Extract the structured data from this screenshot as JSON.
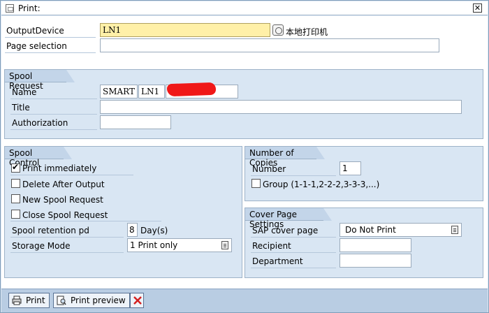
{
  "window": {
    "title": "Print:"
  },
  "output_device": {
    "label": "OutputDevice",
    "value": "LN1",
    "description": "本地打印机"
  },
  "page_selection": {
    "label": "Page selection",
    "value": ""
  },
  "spool_request": {
    "heading": "Spool Request",
    "name_label": "Name",
    "name_part1": "SMART",
    "name_part2": "LN1",
    "title_label": "Title",
    "title_value": "",
    "authorization_label": "Authorization",
    "authorization_value": ""
  },
  "spool_control": {
    "heading": "Spool Control",
    "print_immediately": {
      "label": "Print immediately",
      "checked": true
    },
    "delete_after_output": {
      "label": "Delete After Output",
      "checked": false
    },
    "new_spool_request": {
      "label": "New Spool Request",
      "checked": false
    },
    "close_spool_request": {
      "label": "Close Spool Request",
      "checked": false
    },
    "retention_label": "Spool retention pd",
    "retention_value": "8",
    "retention_unit": "Day(s)",
    "storage_label": "Storage Mode",
    "storage_value": "1 Print only"
  },
  "number_of_copies": {
    "heading": "Number of Copies",
    "number_label": "Number",
    "number_value": "1",
    "group_label": "Group (1-1-1,2-2-2,3-3-3,...)",
    "group_checked": false
  },
  "cover_page": {
    "heading": "Cover Page Settings",
    "sap_cover_label": "SAP cover page",
    "sap_cover_value": "Do Not Print",
    "recipient_label": "Recipient",
    "recipient_value": "",
    "department_label": "Department",
    "department_value": ""
  },
  "footer": {
    "print_label": "Print",
    "preview_label": "Print preview"
  },
  "colors": {
    "required_field": "#fff0a8",
    "group_bg": "#d9e6f3",
    "footer_bg": "#b9cde3",
    "cancel": "#d42020"
  }
}
